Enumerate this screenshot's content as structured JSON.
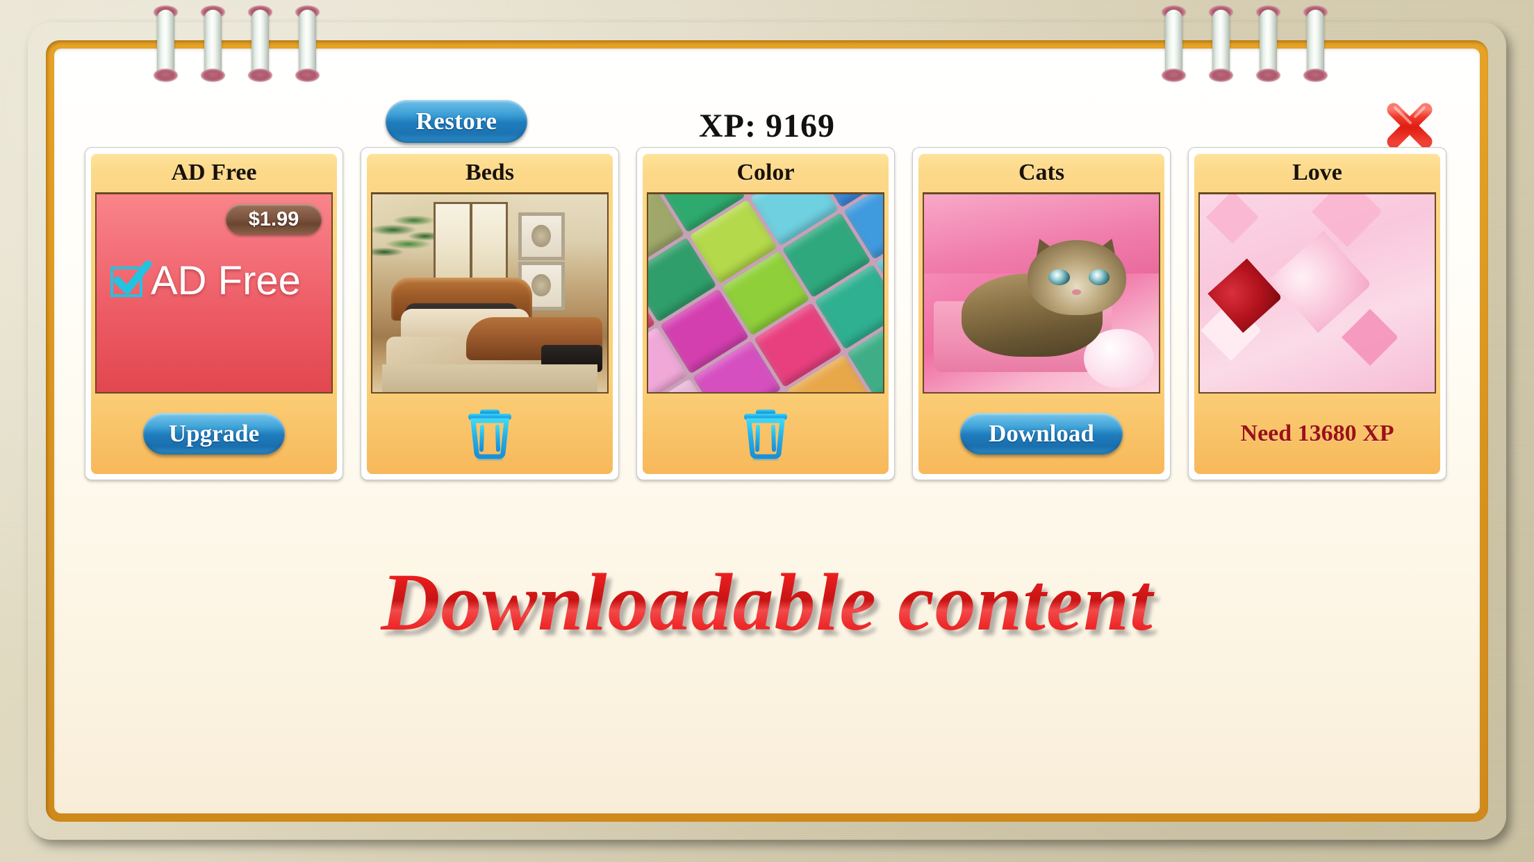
{
  "header": {
    "restore_label": "Restore",
    "xp_label": "XP: 9169",
    "close_icon": "close-x-icon"
  },
  "rings": {
    "left_count": 4,
    "right_count": 4,
    "icon": "spiral-binding-ring"
  },
  "cards": [
    {
      "title": "AD Free",
      "kind": "purchase",
      "price": "$1.99",
      "art_label": "AD Free",
      "art_icon": "checkbox-checked-icon",
      "action_label": "Upgrade",
      "action_type": "button"
    },
    {
      "title": "Beds",
      "kind": "owned",
      "action_label": "",
      "action_icon": "trash-icon",
      "action_type": "icon-button"
    },
    {
      "title": "Color",
      "kind": "owned",
      "action_label": "",
      "action_icon": "trash-icon",
      "action_type": "icon-button"
    },
    {
      "title": "Cats",
      "kind": "available",
      "action_label": "Download",
      "action_type": "button"
    },
    {
      "title": "Love",
      "kind": "locked",
      "action_label": "Need 13680 XP",
      "action_type": "text"
    }
  ],
  "footer": {
    "title": "Downloadable content"
  },
  "colors": {
    "frame_outer": "#eec468",
    "frame_inner": "#d9941f",
    "page": "#fffdf6",
    "card_yellow": "#fbd27f",
    "button_blue": "#1f7dbd",
    "locked_text_red": "#9b1217",
    "title_red": "#ea1d1d",
    "price_brown": "#7d5540",
    "adfree_red": "#ec5a63",
    "trash_cyan": "#22b7e8"
  },
  "color_swatches": [
    "#e6a8b8",
    "#9fa86a",
    "#2faa6e",
    "#5aa8e8",
    "#2f52c8",
    "#e0486e",
    "#2f9e6a",
    "#b4d94a",
    "#6fd0e0",
    "#3b86d8",
    "#f0a8d8",
    "#d43fb0",
    "#8fd03a",
    "#2fa87e",
    "#3f9ade",
    "#e8b6d8",
    "#d64fc0",
    "#e8407e",
    "#2fb090",
    "#56c4d8",
    "#f2d060",
    "#c44fd0",
    "#e8a84a",
    "#3fae86",
    "#8fd06a"
  ]
}
